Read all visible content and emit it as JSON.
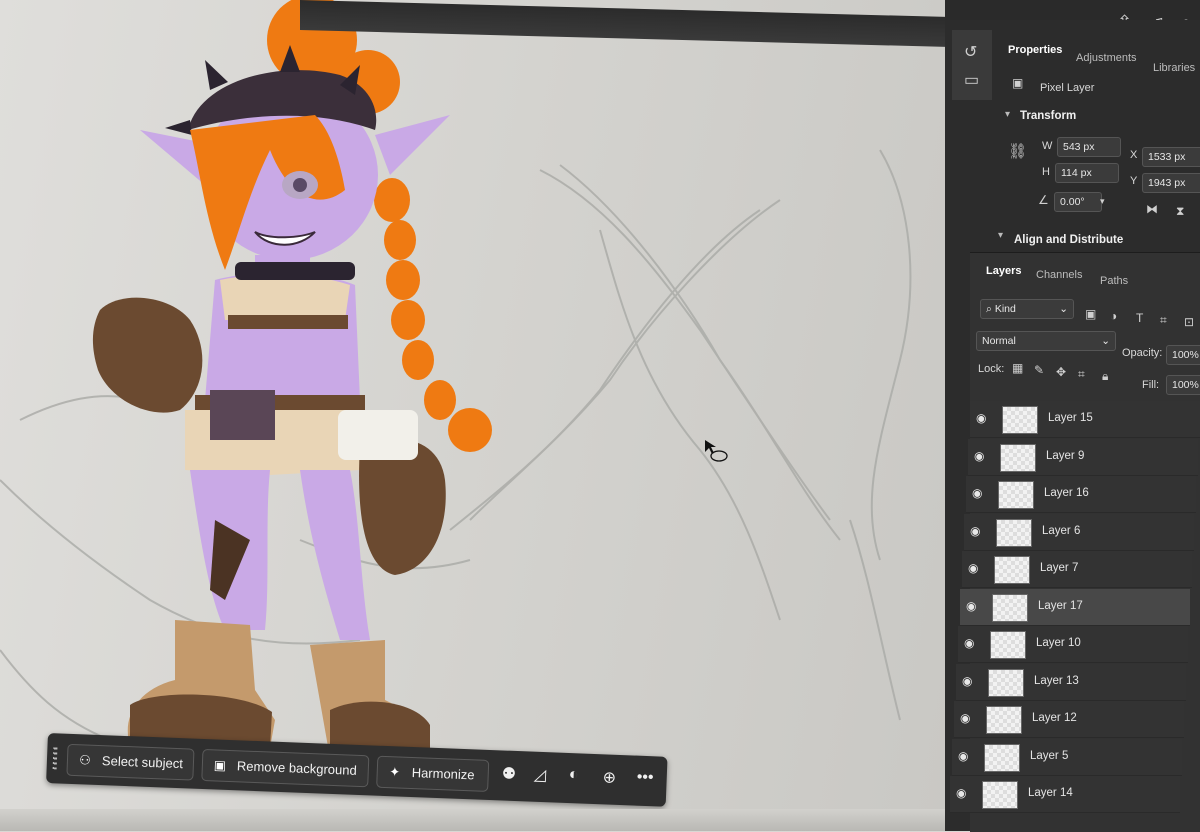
{
  "properties_panel": {
    "tabs": [
      "Properties",
      "Adjustments",
      "Libraries"
    ],
    "layer_kind": "Pixel Layer",
    "transform_title": "Transform",
    "w_label": "W",
    "w_value": "543 px",
    "h_label": "H",
    "h_value": "114 px",
    "x_label": "X",
    "x_value": "1533 px",
    "y_label": "Y",
    "y_value": "1943 px",
    "angle_value": "0.00°",
    "align_title": "Align and Distribute"
  },
  "layers_panel": {
    "tabs": [
      "Layers",
      "Channels",
      "Paths"
    ],
    "filter_kind": "Kind",
    "blend_mode": "Normal",
    "opacity_label": "Opacity:",
    "opacity_value": "100%",
    "lock_label": "Lock:",
    "fill_label": "Fill:",
    "fill_value": "100%",
    "layers": [
      {
        "name": "Layer 15",
        "selected": false
      },
      {
        "name": "Layer 9",
        "selected": false
      },
      {
        "name": "Layer 16",
        "selected": false
      },
      {
        "name": "Layer 6",
        "selected": false
      },
      {
        "name": "Layer 7",
        "selected": false
      },
      {
        "name": "Layer 17",
        "selected": true
      },
      {
        "name": "Layer 10",
        "selected": false
      },
      {
        "name": "Layer 13",
        "selected": false
      },
      {
        "name": "Layer 12",
        "selected": false
      },
      {
        "name": "Layer 5",
        "selected": false
      },
      {
        "name": "Layer 14",
        "selected": false
      }
    ]
  },
  "taskbar": {
    "select_subject": "Select subject",
    "remove_background": "Remove background",
    "harmonize": "Harmonize",
    "more": "•••"
  },
  "header_icons": {
    "collapse": "‹‹"
  },
  "colors": {
    "panel_bg": "#2c2c2c",
    "canvas_bg": "#d9d8d4",
    "skin": "#c9a9e6",
    "hair": "#ef7a12",
    "leather": "#6b4a30",
    "boots": "#c49a6c"
  }
}
